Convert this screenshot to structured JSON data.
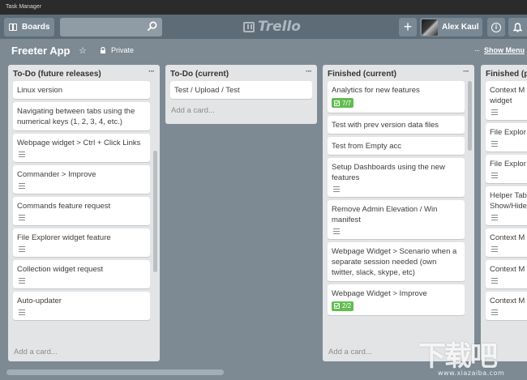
{
  "window": {
    "title": "Task Manager"
  },
  "header": {
    "boards_label": "Boards",
    "logo_text": "Trello",
    "add_label": "+",
    "user_name": "Alex Kaul",
    "info_label": "i"
  },
  "board": {
    "title": "Freeter App",
    "star": "☆",
    "visibility": "Private",
    "menu_dots": "···",
    "show_menu": "Show Menu"
  },
  "lists": [
    {
      "title": "To-Do (future releases)",
      "menu": "···",
      "add_card": "Add a card...",
      "cards": [
        {
          "text": "Linux version",
          "has_desc": false
        },
        {
          "text": "Navigating between tabs using the numerical keys (1, 2, 3, 4, etc.)",
          "has_desc": false
        },
        {
          "text": "Webpage widget > Ctrl + Click Links",
          "has_desc": true
        },
        {
          "text": "Commander > Improve",
          "has_desc": true
        },
        {
          "text": "Commands feature request",
          "has_desc": true
        },
        {
          "text": "File Explorer widget feature",
          "has_desc": true
        },
        {
          "text": "Collection widget request",
          "has_desc": true
        },
        {
          "text": "Auto-updater",
          "has_desc": true
        }
      ]
    },
    {
      "title": "To-Do (current)",
      "menu": "···",
      "add_card": "Add a card...",
      "cards": [
        {
          "text": "Test / Upload / Test",
          "has_desc": false
        }
      ]
    },
    {
      "title": "Finished (current)",
      "menu": "···",
      "add_card": "Add a card...",
      "cards": [
        {
          "text": "Analytics for new features",
          "has_desc": false,
          "badge": "7/7"
        },
        {
          "text": "Test with prev version data files",
          "has_desc": false
        },
        {
          "text": "Test from Empty acc",
          "has_desc": false
        },
        {
          "text": "Setup Dashboards using the new features",
          "has_desc": true
        },
        {
          "text": "Remove Admin Elevation / Win manifest",
          "has_desc": true
        },
        {
          "text": "Webpage Widget > Scenario when a separate session needed (own twitter, slack, skype, etc)",
          "has_desc": false
        },
        {
          "text": "Webpage Widget > Improve",
          "has_desc": false,
          "badge": "2/2"
        }
      ]
    },
    {
      "title": "Finished (p",
      "menu": "",
      "add_card": "",
      "cards": [
        {
          "text": "Context M widget",
          "has_desc": true
        },
        {
          "text": "File Explor",
          "has_desc": true
        },
        {
          "text": "File Explor",
          "has_desc": true
        },
        {
          "text": "Helper Tab Show/Hide",
          "has_desc": true
        },
        {
          "text": "Context M",
          "has_desc": true
        },
        {
          "text": "Context M",
          "has_desc": true
        },
        {
          "text": "Context M",
          "has_desc": true
        }
      ]
    }
  ],
  "watermark": {
    "text": "下载吧",
    "url": "www.xiazaiba.com"
  }
}
